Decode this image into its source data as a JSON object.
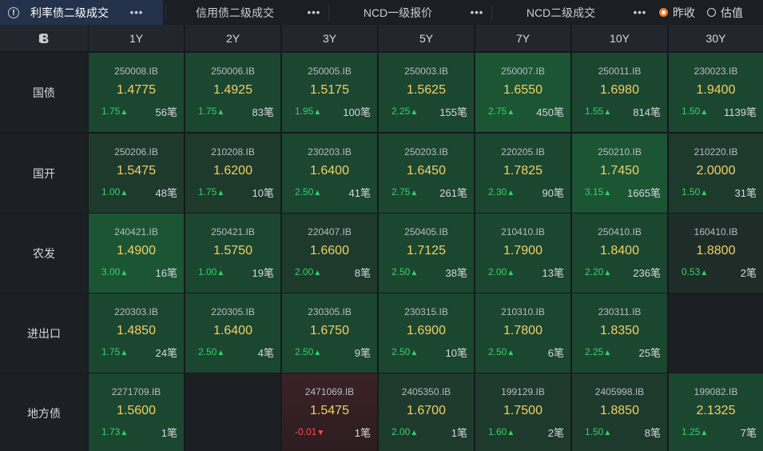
{
  "tabs": [
    {
      "label": "利率债二级成交",
      "active": true
    },
    {
      "label": "信用债二级成交",
      "active": false
    },
    {
      "label": "NCD一级报价",
      "active": false
    },
    {
      "label": "NCD二级成交",
      "active": false
    }
  ],
  "more_glyph": "•••",
  "info_glyph": "!",
  "radios": [
    {
      "label": "昨收",
      "checked": true
    },
    {
      "label": "估值",
      "checked": false
    }
  ],
  "colors": {
    "accent_orange": "#f07a28",
    "yield_yellow": "#f4cf63",
    "up_green": "#33d16b",
    "down_red": "#ff4d4d"
  },
  "corner_icon": "b-logo-icon",
  "tenors": [
    "1Y",
    "2Y",
    "3Y",
    "5Y",
    "7Y",
    "10Y",
    "30Y"
  ],
  "rows": [
    {
      "label": "国债",
      "cells": [
        {
          "code": "250008.IB",
          "yield": "1.4775",
          "chg": "1.75",
          "dir": "up",
          "count": "56笔"
        },
        {
          "code": "250006.IB",
          "yield": "1.4925",
          "chg": "1.75",
          "dir": "up",
          "count": "83笔"
        },
        {
          "code": "250005.IB",
          "yield": "1.5175",
          "chg": "1.95",
          "dir": "up",
          "count": "100笔"
        },
        {
          "code": "250003.IB",
          "yield": "1.5625",
          "chg": "2.25",
          "dir": "up",
          "count": "155笔"
        },
        {
          "code": "250007.IB",
          "yield": "1.6550",
          "chg": "2.75",
          "dir": "up",
          "count": "450笔"
        },
        {
          "code": "250011.IB",
          "yield": "1.6980",
          "chg": "1.55",
          "dir": "up",
          "count": "814笔"
        },
        {
          "code": "230023.IB",
          "yield": "1.9400",
          "chg": "1.50",
          "dir": "up",
          "count": "1139笔"
        }
      ]
    },
    {
      "label": "国开",
      "cells": [
        {
          "code": "250206.IB",
          "yield": "1.5475",
          "chg": "1.00",
          "dir": "up",
          "count": "48笔"
        },
        {
          "code": "210208.IB",
          "yield": "1.6200",
          "chg": "1.75",
          "dir": "up",
          "count": "10笔"
        },
        {
          "code": "230203.IB",
          "yield": "1.6400",
          "chg": "2.50",
          "dir": "up",
          "count": "41笔"
        },
        {
          "code": "250203.IB",
          "yield": "1.6450",
          "chg": "2.75",
          "dir": "up",
          "count": "261笔"
        },
        {
          "code": "220205.IB",
          "yield": "1.7825",
          "chg": "2.30",
          "dir": "up",
          "count": "90笔"
        },
        {
          "code": "250210.IB",
          "yield": "1.7450",
          "chg": "3.15",
          "dir": "up",
          "count": "1665笔"
        },
        {
          "code": "210220.IB",
          "yield": "2.0000",
          "chg": "1.50",
          "dir": "up",
          "count": "31笔"
        }
      ]
    },
    {
      "label": "农发",
      "cells": [
        {
          "code": "240421.IB",
          "yield": "1.4900",
          "chg": "3.00",
          "dir": "up",
          "count": "16笔"
        },
        {
          "code": "250421.IB",
          "yield": "1.5750",
          "chg": "1.00",
          "dir": "up",
          "count": "19笔"
        },
        {
          "code": "220407.IB",
          "yield": "1.6600",
          "chg": "2.00",
          "dir": "up",
          "count": "8笔"
        },
        {
          "code": "250405.IB",
          "yield": "1.7125",
          "chg": "2.50",
          "dir": "up",
          "count": "38笔"
        },
        {
          "code": "210410.IB",
          "yield": "1.7900",
          "chg": "2.00",
          "dir": "up",
          "count": "13笔"
        },
        {
          "code": "250410.IB",
          "yield": "1.8400",
          "chg": "2.20",
          "dir": "up",
          "count": "236笔"
        },
        {
          "code": "160410.IB",
          "yield": "1.8800",
          "chg": "0.53",
          "dir": "up",
          "count": "2笔"
        }
      ]
    },
    {
      "label": "进出口",
      "cells": [
        {
          "code": "220303.IB",
          "yield": "1.4850",
          "chg": "1.75",
          "dir": "up",
          "count": "24笔"
        },
        {
          "code": "220305.IB",
          "yield": "1.6400",
          "chg": "2.50",
          "dir": "up",
          "count": "4笔"
        },
        {
          "code": "230305.IB",
          "yield": "1.6750",
          "chg": "2.50",
          "dir": "up",
          "count": "9笔"
        },
        {
          "code": "230315.IB",
          "yield": "1.6900",
          "chg": "2.50",
          "dir": "up",
          "count": "10笔"
        },
        {
          "code": "210310.IB",
          "yield": "1.7800",
          "chg": "2.50",
          "dir": "up",
          "count": "6笔"
        },
        {
          "code": "230311.IB",
          "yield": "1.8350",
          "chg": "2.25",
          "dir": "up",
          "count": "25笔"
        },
        null
      ]
    },
    {
      "label": "地方债",
      "cells": [
        {
          "code": "2271709.IB",
          "yield": "1.5600",
          "chg": "1.73",
          "dir": "up",
          "count": "1笔"
        },
        null,
        {
          "code": "2471069.IB",
          "yield": "1.5475",
          "chg": "-0.01",
          "dir": "down",
          "count": "1笔"
        },
        {
          "code": "2405350.IB",
          "yield": "1.6700",
          "chg": "2.00",
          "dir": "up",
          "count": "1笔"
        },
        {
          "code": "199129.IB",
          "yield": "1.7500",
          "chg": "1.60",
          "dir": "up",
          "count": "2笔"
        },
        {
          "code": "2405998.IB",
          "yield": "1.8850",
          "chg": "1.50",
          "dir": "up",
          "count": "8笔"
        },
        {
          "code": "199082.IB",
          "yield": "2.1325",
          "chg": "1.25",
          "dir": "up",
          "count": "7笔"
        }
      ]
    }
  ]
}
